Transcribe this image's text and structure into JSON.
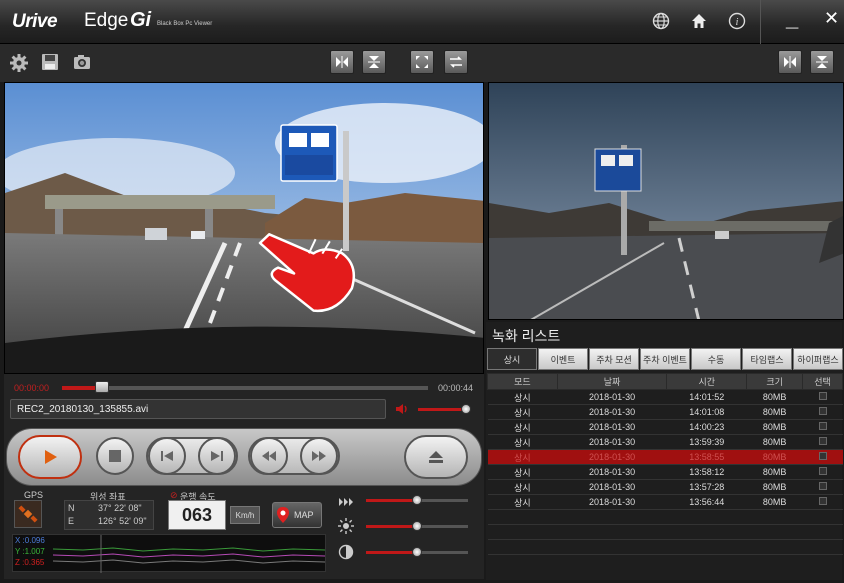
{
  "app": {
    "brand": "Urive",
    "product_edge": "Edge",
    "product_gi": "Gi",
    "subtitle": "Black Box Pc Viewer"
  },
  "titlebar": {
    "globe_icon": "globe-icon",
    "home_icon": "home-icon",
    "info_icon": "info-icon",
    "minimize_label": "_",
    "close_label": "✕"
  },
  "player": {
    "time_current": "00:00:00",
    "time_total": "00:00:44",
    "progress": 0.11,
    "filename": "REC2_20180130_135855.avi",
    "volume": 0.95
  },
  "info": {
    "gps_label": "GPS",
    "coords_label": "위성 좌표",
    "speed_label": "운행 속도",
    "lat_prefix": "N",
    "lat_value": "37° 22' 08\"",
    "lon_prefix": "E",
    "lon_value": "126° 52' 09\"",
    "speed_value": "063",
    "speed_unit": "Km/h",
    "map_label": "MAP",
    "accel_x": "X :0.096",
    "accel_y": "Y :1.007",
    "accel_z": "Z :0.365"
  },
  "adjust": {
    "speed_level": 0.5,
    "brightness_level": 0.5,
    "contrast_level": 0.5
  },
  "reclist": {
    "title": "녹화 리스트",
    "tabs": [
      "상시",
      "이벤트",
      "주차 모션",
      "주차 이벤트",
      "수동",
      "타임랩스",
      "하이퍼랩스"
    ],
    "active_tab": 0,
    "headers": [
      "모드",
      "날짜",
      "시간",
      "크기",
      "선택"
    ],
    "rows": [
      {
        "mode": "상시",
        "date": "2018-01-30",
        "time": "14:01:52",
        "size": "80MB"
      },
      {
        "mode": "상시",
        "date": "2018-01-30",
        "time": "14:01:08",
        "size": "80MB"
      },
      {
        "mode": "상시",
        "date": "2018-01-30",
        "time": "14:00:23",
        "size": "80MB"
      },
      {
        "mode": "상시",
        "date": "2018-01-30",
        "time": "13:59:39",
        "size": "80MB"
      },
      {
        "mode": "상시",
        "date": "2018-01-30",
        "time": "13:58:55",
        "size": "80MB"
      },
      {
        "mode": "상시",
        "date": "2018-01-30",
        "time": "13:58:12",
        "size": "80MB"
      },
      {
        "mode": "상시",
        "date": "2018-01-30",
        "time": "13:57:28",
        "size": "80MB"
      },
      {
        "mode": "상시",
        "date": "2018-01-30",
        "time": "13:56:44",
        "size": "80MB"
      }
    ],
    "selected_row": 4
  }
}
